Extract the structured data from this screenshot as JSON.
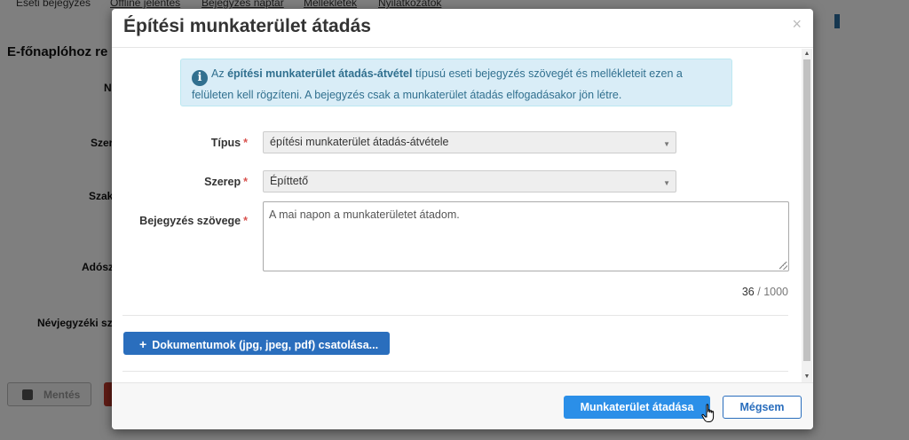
{
  "background": {
    "tabs": [
      "Eseti bejegyzés",
      "Offline jelentés",
      "Bejegyzés naptár",
      "Mellékletek",
      "Nyilatkozatok"
    ],
    "heading": "E-főnaplóhoz re",
    "labels": [
      "N",
      "Szer",
      "Szak",
      "Adósz",
      "Névjegyzéki sz"
    ],
    "save_button": "Mentés"
  },
  "modal": {
    "title": "Építési munkaterület átadás",
    "close_symbol": "×",
    "info": {
      "icon": "i",
      "text_before": "Az ",
      "text_bold": "építési munkaterület átadás-átvétel",
      "text_after": " típusú eseti bejegyzés szövegét és mellékleteit ezen a felületen kell rögzíteni. A bejegyzés csak a munkaterület átadás elfogadásakor jön létre."
    },
    "fields": {
      "type": {
        "label": "Típus",
        "required": "*",
        "value": "építési munkaterület átadás-átvétele"
      },
      "role": {
        "label": "Szerep",
        "required": "*",
        "value": "Építtető"
      },
      "text": {
        "label": "Bejegyzés szövege",
        "required": "*",
        "value": "A mai napon a munkaterületet átadom."
      }
    },
    "counter": {
      "current": "36",
      "separator": " / ",
      "max": "1000"
    },
    "attach_button": {
      "plus": "+",
      "label": "Dokumentumok (jpg, jpeg, pdf) csatolása..."
    },
    "footer": {
      "submit_label": "Munkaterület átadása",
      "cancel_label": "Mégsem"
    }
  },
  "colors": {
    "primary": "#2b8fe8",
    "attach": "#2a6ebd",
    "info_bg": "#d9edf7",
    "info_text": "#31708f",
    "required": "#d9534f"
  }
}
